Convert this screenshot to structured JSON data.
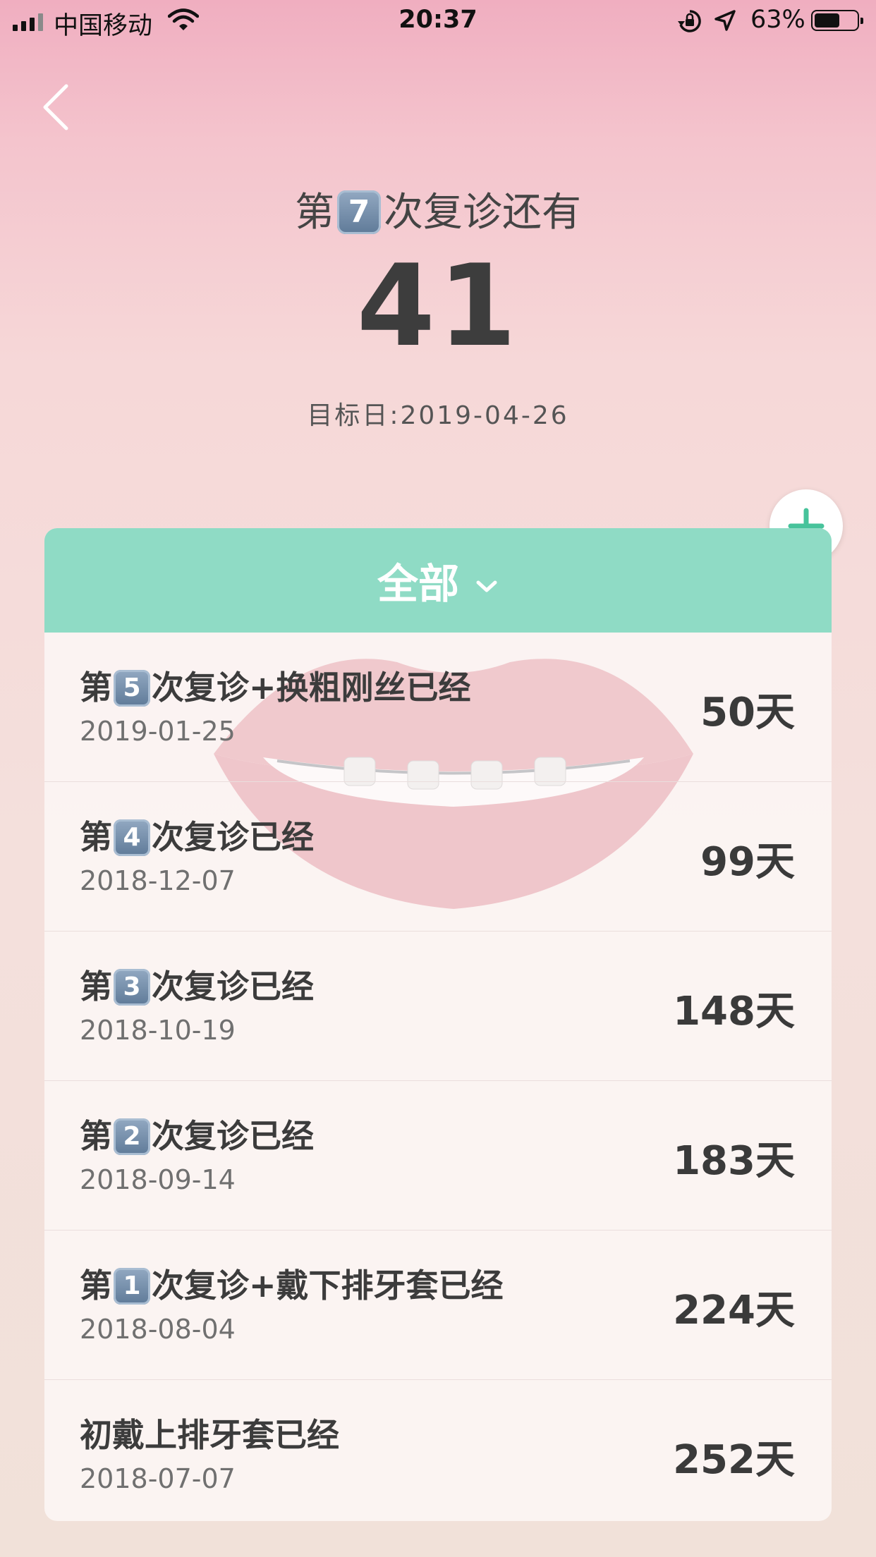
{
  "status_bar": {
    "carrier": "中国移动",
    "time": "20:37",
    "battery_percent_label": "63%",
    "battery_level": 0.63
  },
  "hero": {
    "prefix": "第",
    "number": "7",
    "suffix": "次复诊还有",
    "count": "41",
    "target_date": "目标日:2019-04-26"
  },
  "filter": {
    "label": "全部"
  },
  "records": [
    {
      "prefix": "第",
      "number": "5",
      "suffix": "次复诊+换粗刚丝已经",
      "date": "2019-01-25",
      "days": "50天"
    },
    {
      "prefix": "第",
      "number": "4",
      "suffix": "次复诊已经",
      "date": "2018-12-07",
      "days": "99天"
    },
    {
      "prefix": "第",
      "number": "3",
      "suffix": "次复诊已经",
      "date": "2018-10-19",
      "days": "148天"
    },
    {
      "prefix": "第",
      "number": "2",
      "suffix": "次复诊已经",
      "date": "2018-09-14",
      "days": "183天"
    },
    {
      "prefix": "第",
      "number": "1",
      "suffix": "次复诊+戴下排牙套已经",
      "date": "2018-08-04",
      "days": "224天"
    },
    {
      "prefix": "",
      "number": "",
      "suffix": "初戴上排牙套已经",
      "date": "2018-07-07",
      "days": "252天"
    }
  ],
  "colors": {
    "accent": "#8fdbc5",
    "keycap": "#6f88a6",
    "add_icon": "#47c39b"
  },
  "icons": {
    "back": "chevron-left-icon",
    "add": "plus-icon",
    "filter": "chevron-down-icon",
    "wifi": "wifi-icon",
    "location": "location-arrow-icon",
    "rotation_lock": "rotation-lock-icon"
  }
}
